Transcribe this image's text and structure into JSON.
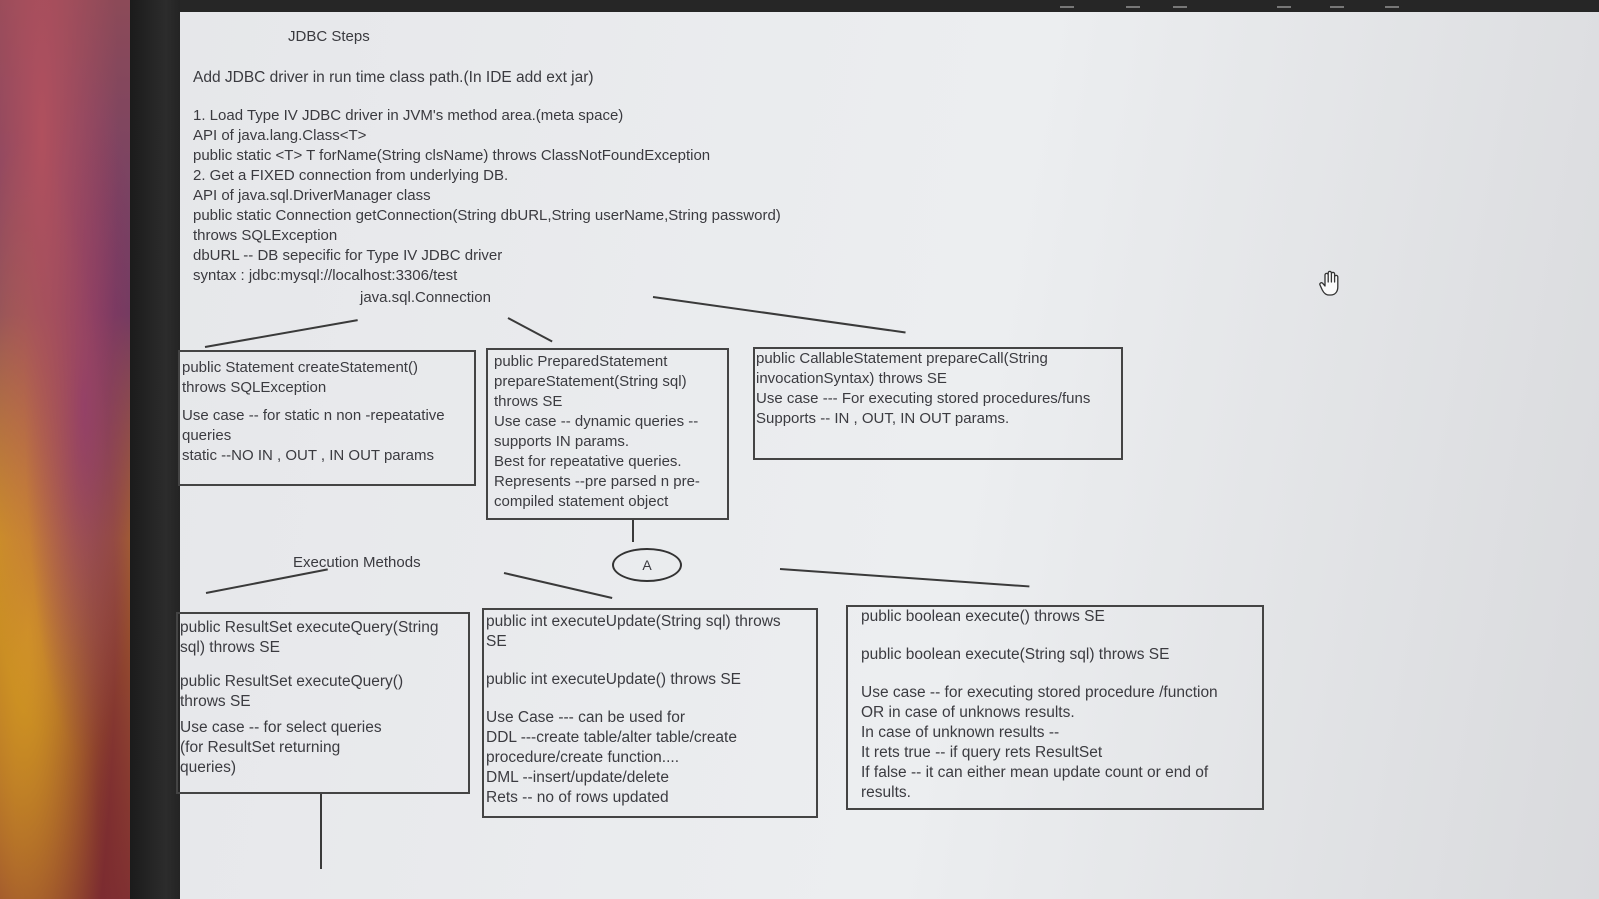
{
  "doc": {
    "title": "JDBC Steps",
    "intro": "Add JDBC driver in run time class path.(In IDE add ext jar)",
    "steps": [
      "1. Load Type IV JDBC driver in JVM's method area.(meta space)",
      "API of java.lang.Class<T>",
      "public static <T> T forName(String clsName) throws ClassNotFoundException",
      "2. Get a FIXED connection from underlying DB.",
      "API of java.sql.DriverManager class",
      "public static Connection getConnection(String dbURL,String userName,String password)",
      "throws SQLException",
      "dbURL -- DB sepecific for Type IV JDBC driver",
      "syntax : jdbc:mysql://localhost:3306/test"
    ],
    "connection_label": "java.sql.Connection",
    "statement_box": [
      "public Statement createStatement()",
      "throws SQLException",
      "Use case -- for static n non -repeatative",
      "queries",
      "static --NO IN , OUT , IN OUT params"
    ],
    "prepared_box": [
      "public PreparedStatement",
      "prepareStatement(String sql)",
      "throws SE",
      "Use case -- dynamic queries --",
      "supports IN params.",
      "Best for repeatative queries.",
      "Represents --pre parsed n pre-",
      "compiled statement object"
    ],
    "callable_box": [
      "public CallableStatement prepareCall(String",
      "invocationSyntax) throws SE",
      "Use case --- For executing stored procedures/funs",
      "Supports -- IN , OUT, IN OUT params."
    ],
    "oval_label": "A",
    "execution_label": "Execution Methods",
    "query_box": [
      "public ResultSet executeQuery(String",
      "sql) throws SE",
      "public ResultSet executeQuery()",
      "throws SE",
      "Use case -- for select queries",
      "(for ResultSet returning",
      "queries)"
    ],
    "update_box": [
      "public int executeUpdate(String sql) throws",
      "SE",
      "public int executeUpdate() throws SE",
      "Use Case --- can be used for",
      "DDL ---create table/alter table/create",
      "procedure/create function....",
      "DML --insert/update/delete",
      "Rets -- no of rows updated"
    ],
    "execute_box": [
      "public boolean execute() throws SE",
      "public boolean execute(String sql) throws SE",
      "Use case -- for executing stored procedure /function",
      "OR in case of unknows results.",
      "In case of unknown results --",
      "It rets true -- if query rets ResultSet",
      "If false -- it can either mean update count or end of",
      "results."
    ]
  },
  "icons": {
    "cursor": "hand-pointer-icon"
  }
}
